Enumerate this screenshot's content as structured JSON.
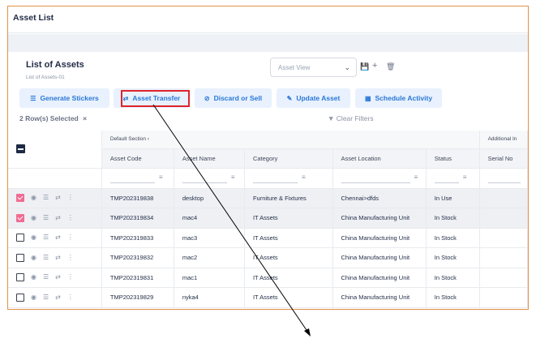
{
  "app": {
    "title": "Asset List"
  },
  "page": {
    "heading": "List of Assets",
    "subheading": "List of Assets-01"
  },
  "view_select": {
    "placeholder": "Asset View"
  },
  "toolbar": {
    "icons": [
      "save-icon",
      "plus-icon",
      "trash-icon"
    ],
    "buttons": [
      {
        "label": "Generate Stickers",
        "icon": "list-icon"
      },
      {
        "label": "Asset Transfer",
        "icon": "transfer-icon",
        "highlighted": true
      },
      {
        "label": "Discard or Sell",
        "icon": "ban-icon"
      },
      {
        "label": "Update Asset",
        "icon": "edit-icon"
      },
      {
        "label": "Schedule Activity",
        "icon": "calendar-icon"
      }
    ]
  },
  "selection": {
    "text": "2 Row(s) Selected",
    "clear_icon": "×"
  },
  "filters": {
    "clear_label": "Clear Filters"
  },
  "table": {
    "sections": {
      "default": "Default Section",
      "additional": "Additional In"
    },
    "columns": [
      "Asset Code",
      "Asset Name",
      "Category",
      "Asset Location",
      "Status",
      "Serial No"
    ],
    "rows": [
      {
        "selected": true,
        "code": "TMP202319838",
        "name": "desktop",
        "category": "Furniture & Fixtures",
        "location": "Chennai>dfds",
        "status": "In Use",
        "serial": ""
      },
      {
        "selected": true,
        "code": "TMP202319834",
        "name": "mac4",
        "category": "IT Assets",
        "location": "China Manufacturing Unit",
        "status": "In Stock",
        "serial": ""
      },
      {
        "selected": false,
        "code": "TMP202319833",
        "name": "mac3",
        "category": "IT Assets",
        "location": "China Manufacturing Unit",
        "status": "In Stock",
        "serial": ""
      },
      {
        "selected": false,
        "code": "TMP202319832",
        "name": "mac2",
        "category": "IT Assets",
        "location": "China Manufacturing Unit",
        "status": "In Stock",
        "serial": ""
      },
      {
        "selected": false,
        "code": "TMP202319831",
        "name": "mac1",
        "category": "IT Assets",
        "location": "China Manufacturing Unit",
        "status": "In Stock",
        "serial": ""
      },
      {
        "selected": false,
        "code": "TMP202319829",
        "name": "nyka4",
        "category": "IT Assets",
        "location": "China Manufacturing Unit",
        "status": "In Stock",
        "serial": ""
      }
    ]
  },
  "colors": {
    "accent": "#2a78d6",
    "button_bg": "#e8f1fd",
    "highlight": "#e0242b",
    "checkbox": "#f06b93",
    "frame_border": "#e0914a"
  }
}
